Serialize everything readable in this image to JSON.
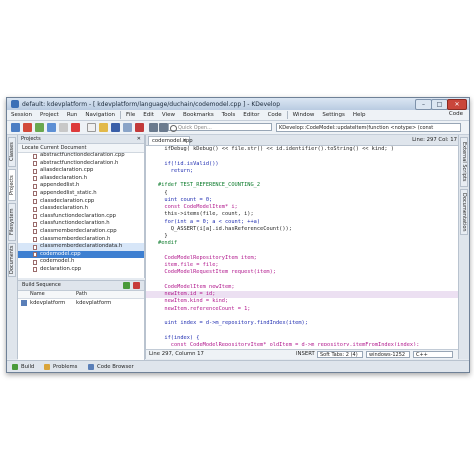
{
  "window": {
    "title": "default: kdevplatform - [ kdevplatform/language/duchain/codemodel.cpp ] - KDevelop",
    "min": "–",
    "max": "□",
    "close": "✕"
  },
  "menu": {
    "items": [
      "Session",
      "Project",
      "Run",
      "Navigation",
      "File",
      "Edit",
      "View",
      "Bookmarks",
      "Tools",
      "Editor",
      "Code",
      "Window",
      "Settings",
      "Help"
    ],
    "kde_label": "Code"
  },
  "toolbar": {
    "quick_open_placeholder": "Quick Open...",
    "breadcrumb": "KDevelop::CodeModel::updateItem(function <notype> (const"
  },
  "left_tabs": [
    "Classes",
    "Projects",
    "Filesystem",
    "Documents"
  ],
  "right_tabs": [
    "External Scripts",
    "Documentation"
  ],
  "projects_panel": {
    "title": "Projects",
    "close": "✕",
    "locate": "Locate Current Document",
    "files": [
      "abstractfunctiondeclaration.cpp",
      "abstractfunctiondeclaration.h",
      "aliasdeclaration.cpp",
      "aliasdeclaration.h",
      "appendedlist.h",
      "appendedlist_static.h",
      "classdeclaration.cpp",
      "classdeclaration.h",
      "classfunctiondeclaration.cpp",
      "classfunctiondeclaration.h",
      "classmemberdeclaration.cpp",
      "classmemberdeclaration.h",
      "classmemberdeclarationdata.h",
      "codemodel.cpp",
      "codemodel.h",
      "declaration.cpp"
    ],
    "selected_index": 13
  },
  "build_sequence": {
    "title": "Build Sequence",
    "col_name": "Name",
    "col_path": "Path",
    "rows": [
      {
        "name": "kdevplatform",
        "path": "kdevplatform"
      }
    ]
  },
  "editor": {
    "tab_label": "codemodel.cpp",
    "tab_close": "✕",
    "line_col": "Line: 297 Col: 17",
    "status_pos": "Line 297, Column 17",
    "status_mode": "INSERT",
    "soft_tabs": "Soft Tabs: 2 (4)",
    "encoding": "windows-1252",
    "language": "C++",
    "code_lines": [
      "  ifDebug( kDebug() << file.str() << id.identifier().toString() << kind; )",
      "",
      "  if(!id.isValid())",
      "    return;",
      "",
      "#ifdef TEST_REFERENCE_COUNTING_2",
      "  {",
      "  uint count = 0;",
      "  const CodeModelItem* i;",
      "  this->items(file, count, i);",
      "  for(int a = 0; a < count; ++a)",
      "    Q_ASSERT(i[a].id.hasReferenceCount());",
      "  }",
      "#endif",
      "",
      "  CodeModelRepositoryItem item;",
      "  item.file = file;",
      "  CodeModelRequestItem request(item);",
      "",
      "  CodeModelItem newItem;",
      "  newItem.id = id;",
      "  newItem.kind = kind;",
      "  newItem.referenceCount = 1;",
      "",
      "  uint index = d->m_repository.findIndex(item);",
      "",
      "  if(index) {",
      "    const CodeModelRepositoryItem* oldItem = d->m_repository.itemFromIndex(index);"
    ]
  },
  "statusbar": {
    "tabs": [
      "Build",
      "Problems",
      "Code Browser"
    ]
  },
  "colors": {
    "selection": "#3d7fd1",
    "keyword": "#1d2bb0",
    "string": "#b0158b",
    "preprocessor": "#0a7a2a"
  }
}
